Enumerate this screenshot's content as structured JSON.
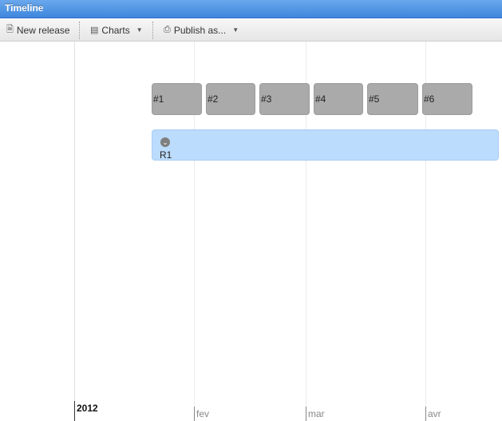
{
  "window": {
    "title": "Timeline"
  },
  "toolbar": {
    "new_release_label": "New release",
    "charts_label": "Charts",
    "publish_label": "Publish as..."
  },
  "timeline": {
    "year_label": "2012",
    "months": [
      "fev",
      "mar",
      "avr"
    ],
    "iterations": [
      "#1",
      "#2",
      "#3",
      "#4",
      "#5",
      "#6"
    ],
    "release": {
      "label": "R1"
    }
  },
  "colors": {
    "titlebar": "#4a90e2",
    "iteration_fill": "#aaaaaa",
    "release_fill": "#bcdcfd"
  },
  "icons": {
    "new_release": "document-icon",
    "charts": "chart-icon",
    "publish": "printer-icon",
    "release_toggle": "chevron-down-icon"
  }
}
